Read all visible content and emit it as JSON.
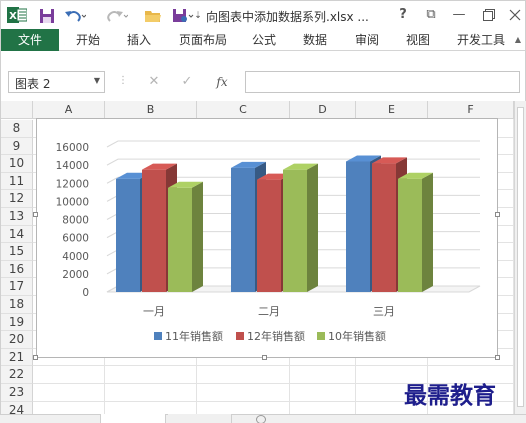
{
  "window": {
    "title": "向图表中添加数据系列.xlsx ...",
    "help": "?",
    "restore": "⧉",
    "minimize": "—"
  },
  "ribbon": {
    "file": "文件",
    "tabs": [
      "开始",
      "插入",
      "页面布局",
      "公式",
      "数据",
      "审阅",
      "视图",
      "开发工具"
    ]
  },
  "formula_bar": {
    "name_box": "图表 2",
    "cancel": "✕",
    "enter": "✓",
    "fx": "fx",
    "formula": ""
  },
  "grid": {
    "columns": [
      "A",
      "B",
      "C",
      "D",
      "E",
      "F"
    ],
    "rows": [
      "8",
      "9",
      "10",
      "11",
      "12",
      "13",
      "14",
      "15",
      "16",
      "17",
      "18",
      "19",
      "20",
      "21",
      "22",
      "23",
      "24"
    ]
  },
  "chart_data": {
    "type": "bar",
    "style": "3d-clustered-column",
    "categories": [
      "一月",
      "二月",
      "三月"
    ],
    "series": [
      {
        "name": "11年销售额",
        "color": "#4f81bd",
        "values": [
          12500,
          13700,
          14400
        ]
      },
      {
        "name": "12年销售额",
        "color": "#c0504d",
        "values": [
          13500,
          12400,
          14200
        ]
      },
      {
        "name": "10年销售额",
        "color": "#9bbb59",
        "values": [
          11500,
          13500,
          12500
        ]
      }
    ],
    "ylim": [
      0,
      16000
    ],
    "yticks": [
      "16000",
      "14000",
      "12000",
      "10000",
      "8000",
      "6000",
      "4000",
      "2000",
      "0"
    ],
    "grid": true,
    "legend_position": "bottom"
  },
  "watermark": "最需教育"
}
